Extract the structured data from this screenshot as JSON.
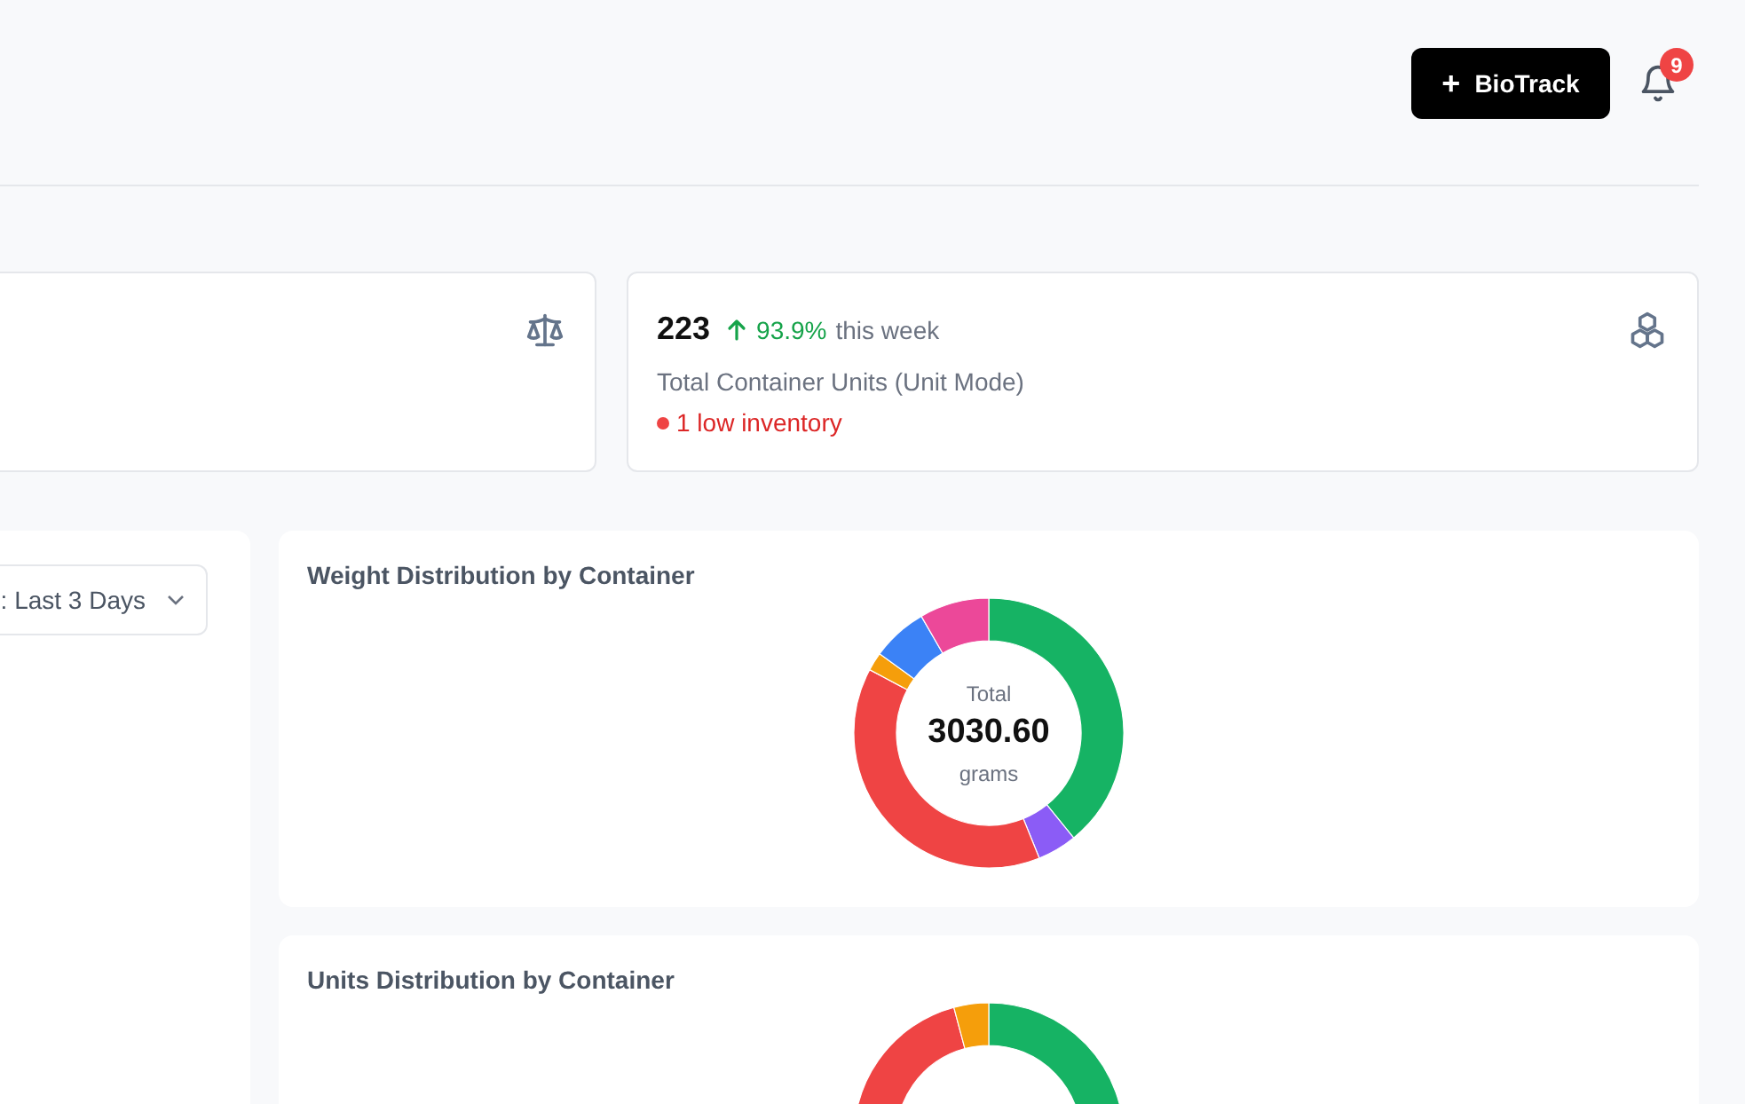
{
  "header": {
    "primary_button": {
      "icon": "+",
      "label": "BioTrack"
    },
    "notifications": {
      "count": "9"
    }
  },
  "stat_cards": [
    {
      "kind": "weight"
    },
    {
      "kind": "units",
      "value": "223",
      "change": "93.9%",
      "change_suffix": "this week",
      "label": "Total Container Units (Unit Mode)",
      "alert": "1 low inventory"
    }
  ],
  "filter_panel": {
    "dropdown": {
      "value": ": Last 3 Days"
    }
  },
  "charts": [
    {
      "title": "Weight Distribution by Container",
      "center_label": "Total",
      "center_value": "3030.60",
      "center_unit": "grams"
    },
    {
      "title": "Units Distribution by Container"
    }
  ]
}
